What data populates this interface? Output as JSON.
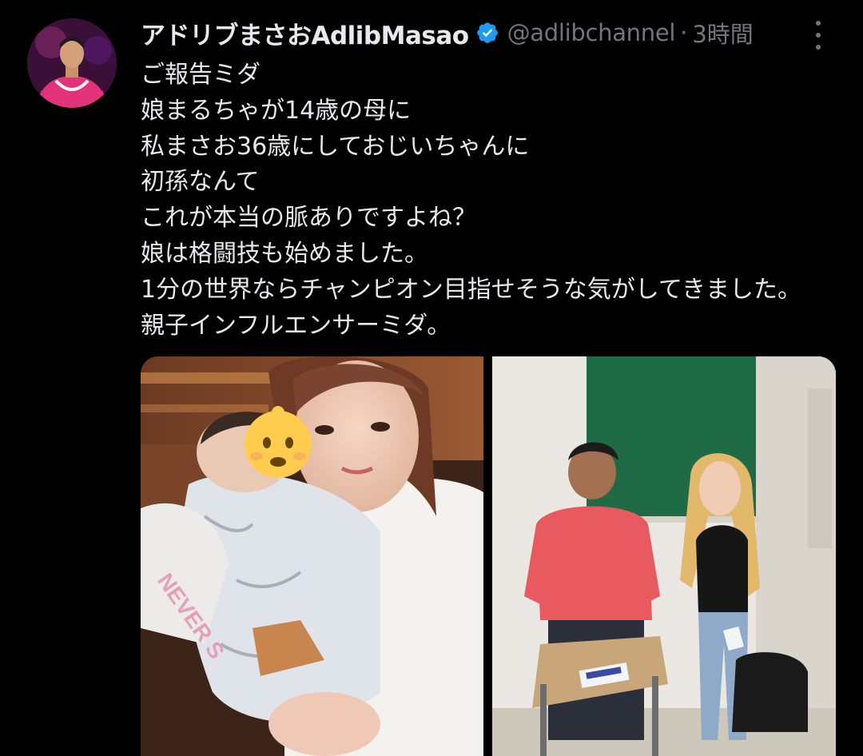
{
  "tweet": {
    "display_name": "アドリブまさおAdlibMasao",
    "handle": "@adlibchannel",
    "separator": "·",
    "timestamp": "3時間",
    "verified": true,
    "lines": [
      "ご報告ミダ",
      "娘まるちゃが14歳の母に",
      "私まさお36歳にしておじいちゃんに",
      "初孫なんて",
      "これが本当の脈ありですよね？",
      "娘は格闘技も始めました。",
      "1分の世界ならチャンピオン目指せそうな気がしてきました。",
      "親子インフルエンサーミダ。"
    ]
  },
  "media": {
    "left_photo": {
      "text": "NEVER S"
    },
    "right_photo": {}
  },
  "colors": {
    "background": "#000000",
    "text_primary": "#e7e9ea",
    "text_secondary": "#71767b",
    "verified_blue": "#1d9bf0"
  },
  "icons": {
    "verified": "verified-badge-icon",
    "more": "more-vertical-icon",
    "baby_emoji": "baby-emoji-icon"
  }
}
